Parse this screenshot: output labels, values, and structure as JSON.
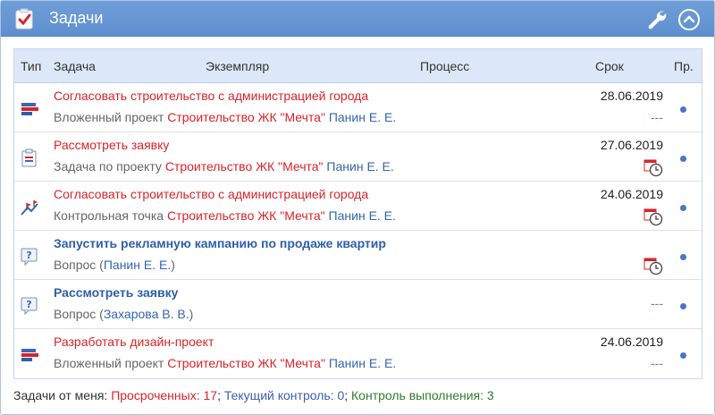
{
  "header": {
    "title": "Задачи",
    "icons": [
      "checklist-icon",
      "wrench-icon",
      "chevron-up-icon"
    ]
  },
  "columns": {
    "type": "Тип",
    "task": "Задача",
    "instance": "Экземпляр",
    "process": "Процесс",
    "due": "Срок",
    "priority": "Пр."
  },
  "rows": [
    {
      "icon": "project-icon",
      "title": "Согласовать строительство с администрацией города",
      "title_style": "red",
      "kind": "Вложенный проект",
      "project": "Строительство ЖК \"Мечта\"",
      "person": "Панин Е. Е.",
      "date": "28.06.2019",
      "extra": "---"
    },
    {
      "icon": "task-icon",
      "title": "Рассмотреть заявку",
      "title_style": "red",
      "kind": "Задача по проекту",
      "project": "Строительство ЖК \"Мечта\"",
      "person": "Панин Е. Е.",
      "date": "27.06.2019",
      "extra": "overdue-clock-icon"
    },
    {
      "icon": "milestone-icon",
      "title": "Согласовать строительство с администрацией города",
      "title_style": "red",
      "kind": "Контрольная точка",
      "project": "Строительство ЖК \"Мечта\"",
      "person": "Панин Е. Е.",
      "date": "24.06.2019",
      "extra": "overdue-clock-icon"
    },
    {
      "icon": "question-icon",
      "title": "Запустить рекламную кампанию по продаже квартир",
      "title_style": "bold-blue",
      "kind": "Вопрос (",
      "person": "Панин Е. Е.",
      "kind_close": ")",
      "date": "",
      "extra": "overdue-clock-icon"
    },
    {
      "icon": "question-icon",
      "title": "Рассмотреть заявку",
      "title_style": "bold-blue",
      "kind": "Вопрос (",
      "person": "Захарова В. В.",
      "kind_close": ")",
      "date": "",
      "extra": "---"
    },
    {
      "icon": "project-icon",
      "title": "Разработать дизайн-проект",
      "title_style": "red",
      "kind": "Вложенный проект",
      "project": "Строительство ЖК \"Мечта\"",
      "person": "Панин Е. Е.",
      "date": "24.06.2019",
      "extra": "---"
    }
  ],
  "footer": {
    "prefix": "Задачи от меня:",
    "overdue_label": "Просроченных:",
    "overdue_count": "17",
    "current_label": "Текущий контроль:",
    "current_count": "0",
    "control_label": "Контроль выполнения:",
    "control_count": "3"
  },
  "colors": {
    "header_bg": "#6a99d6",
    "accent_red": "#d8232a",
    "accent_blue": "#3465b0",
    "accent_green": "#2f7d2f"
  }
}
